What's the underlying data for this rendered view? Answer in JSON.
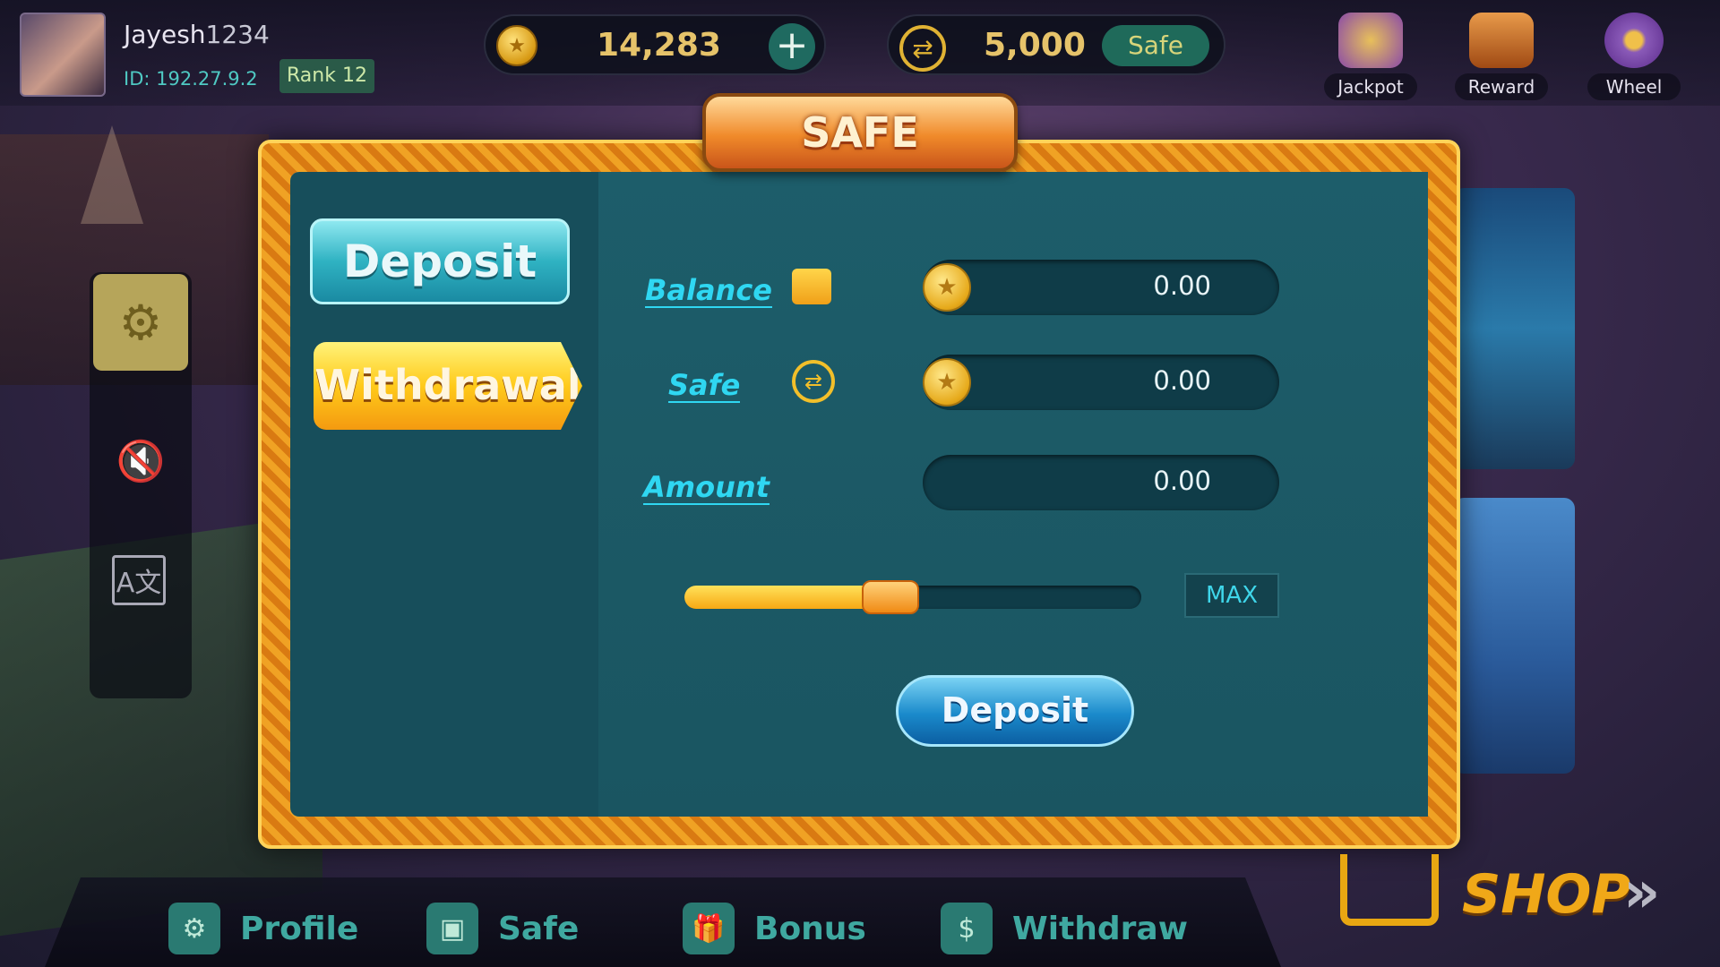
{
  "user": {
    "name_prefix": "Jayesh",
    "name_suffix": "1234",
    "id": "ID: 192.27.9.2",
    "rank": "Rank 12"
  },
  "currency": {
    "coins": "14,283",
    "safe_amount": "5,000",
    "safe_chip": "Safe"
  },
  "top_icons": [
    {
      "label": "Jackpot",
      "icon": "jackpot-icon",
      "color": "#c98a2a"
    },
    {
      "label": "Reward",
      "icon": "treasure-chest-icon",
      "color": "#c0601a"
    },
    {
      "label": "Wheel",
      "icon": "wheel-icon",
      "color": "#8a5ab8"
    }
  ],
  "side_menu": {
    "settings_icon": "gear-icon",
    "sound_icon": "mute-icon",
    "language_icon": "translate-icon",
    "language_glyph": "A文"
  },
  "dialog": {
    "title": "SAFE",
    "tabs": {
      "deposit": "Deposit",
      "withdrawal": "Withdrawal",
      "active": "withdrawal"
    },
    "rows": {
      "balance_label": "Balance",
      "balance_value": "0.00",
      "safe_label": "Safe",
      "safe_value": "0.00",
      "amount_label": "Amount",
      "amount_value": "0.00"
    },
    "slider_fraction": 0.45,
    "max_label": "MAX",
    "submit_label": "Deposit"
  },
  "bottom_nav": [
    {
      "label": "Profile",
      "icon": "profile-gear-icon"
    },
    {
      "label": "Safe",
      "icon": "safe-icon"
    },
    {
      "label": "Bonus",
      "icon": "gift-icon"
    },
    {
      "label": "Withdraw",
      "icon": "money-bag-icon"
    }
  ],
  "shop": {
    "label": "SHOP",
    "arrow": "»"
  },
  "colors": {
    "accent_cyan": "#2fd7f2",
    "frame_orange": "#f0a224",
    "gold": "#e6c36a"
  }
}
